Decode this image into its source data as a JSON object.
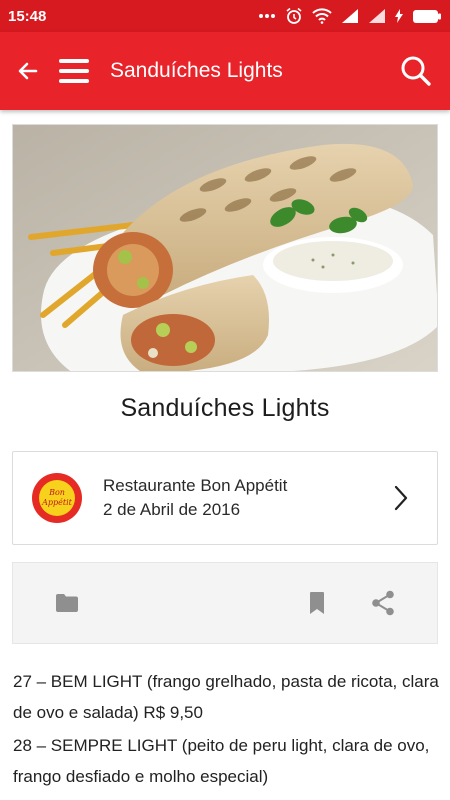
{
  "status_bar": {
    "time": "15:48",
    "icons": [
      "dots-icon",
      "alarm-icon",
      "wifi-icon",
      "signal-icon",
      "signal-icon",
      "charging-icon",
      "battery-icon"
    ]
  },
  "app_bar": {
    "title": "Sanduíches Lights",
    "icons": [
      "arrow-back-icon",
      "menu-icon",
      "search-icon"
    ],
    "color": "#e8232a"
  },
  "post": {
    "title": "Sanduíches Lights",
    "source": {
      "name": "Restaurante Bon Appétit",
      "date": "2 de Abril de 2016",
      "logo_text_1": "Bon",
      "logo_text_2": "Appétit"
    },
    "actions": [
      "folder-icon",
      "bookmark-icon",
      "share-icon"
    ],
    "paragraphs": [
      "27 – BEM LIGHT (frango grelhado, pasta de ricota, clara de ovo e salada) R$ 9,50",
      "28 – SEMPRE LIGHT (peito de peru light, clara de ovo, frango desfiado e molho especial)"
    ]
  }
}
